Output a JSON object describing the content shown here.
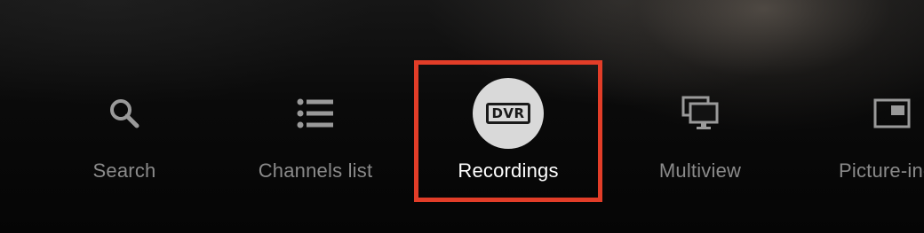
{
  "menu": {
    "items": [
      {
        "label": "Search",
        "icon": "search-icon",
        "selected": false
      },
      {
        "label": "Channels list",
        "icon": "list-icon",
        "selected": false
      },
      {
        "label": "Recordings",
        "icon": "dvr-icon",
        "icon_text": "DVR",
        "selected": true
      },
      {
        "label": "Multiview",
        "icon": "multiview-icon",
        "selected": false
      },
      {
        "label": "Picture-in-pi",
        "icon": "picture-in-picture-icon",
        "selected": false
      }
    ]
  },
  "colors": {
    "highlight": "#e23d28",
    "label_inactive": "#8a8a8a",
    "label_active": "#ffffff",
    "icon_inactive": "#9a9a9a",
    "dvr_circle": "#d9d9d9"
  }
}
